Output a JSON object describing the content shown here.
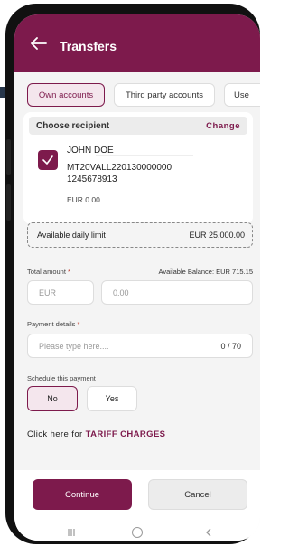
{
  "header": {
    "title": "Transfers"
  },
  "tabs": [
    {
      "label": "Own accounts",
      "active": true
    },
    {
      "label": "Third party accounts",
      "active": false
    },
    {
      "label": "Use",
      "active": false
    }
  ],
  "recipient": {
    "title": "Choose recipient",
    "change_label": "Change",
    "name": "JOHN DOE",
    "iban_line1": "MT20VALL220130000000",
    "iban_line2": "1245678913",
    "balance": "EUR 0.00",
    "selected": true
  },
  "daily_limit": {
    "label": "Available daily limit",
    "value": "EUR 25,000.00"
  },
  "amount": {
    "label": "Total amount",
    "required_marker": "*",
    "available_balance": "Available Balance: EUR 715.15",
    "currency": "EUR",
    "value": "0.00"
  },
  "payment_details": {
    "label": "Payment details",
    "required_marker": "*",
    "placeholder": "Please type here....",
    "counter": "0 / 70"
  },
  "schedule": {
    "label": "Schedule this payment",
    "no_label": "No",
    "yes_label": "Yes",
    "selected": "No"
  },
  "tariff": {
    "prefix": "Click here for",
    "link": "TARIFF CHARGES"
  },
  "footer": {
    "continue_label": "Continue",
    "cancel_label": "Cancel"
  },
  "colors": {
    "brand": "#7d1a4c",
    "brand_light": "#f4e6ed",
    "background": "#f4f4f4"
  },
  "icons": {
    "back": "arrow-left-icon",
    "check": "checkmark-icon",
    "nav_recents": "recents-icon",
    "nav_home": "home-circle-icon",
    "nav_back": "chevron-left-icon"
  }
}
